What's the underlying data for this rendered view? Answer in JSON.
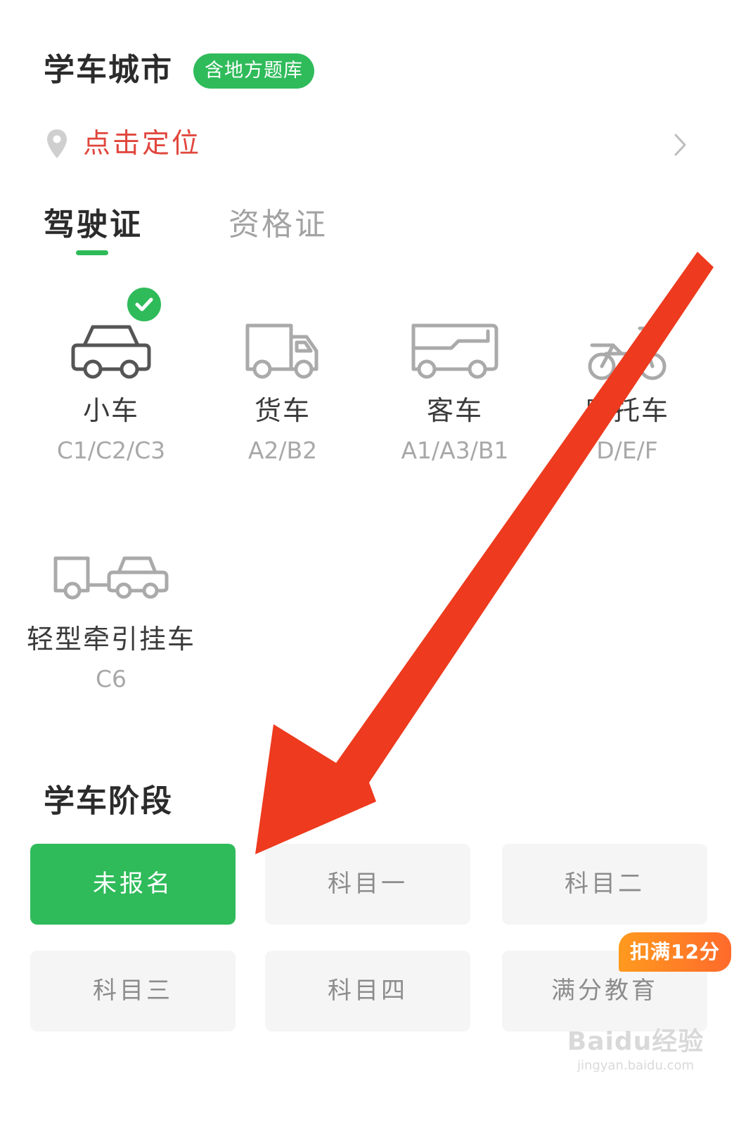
{
  "header": {
    "title": "学车城市",
    "badge": "含地方题库"
  },
  "location": {
    "icon": "location-pin-icon",
    "text": "点击定位",
    "chevron": "chevron-right-icon"
  },
  "tabs": [
    {
      "label": "驾驶证",
      "active": true
    },
    {
      "label": "资格证",
      "active": false
    }
  ],
  "vehicles": [
    {
      "name": "小车",
      "code": "C1/C2/C3",
      "icon": "car-icon",
      "selected": true
    },
    {
      "name": "货车",
      "code": "A2/B2",
      "icon": "truck-icon",
      "selected": false
    },
    {
      "name": "客车",
      "code": "A1/A3/B1",
      "icon": "bus-icon",
      "selected": false
    },
    {
      "name": "摩托车",
      "code": "D/E/F",
      "icon": "motorcycle-icon",
      "selected": false
    },
    {
      "name": "轻型牵引挂车",
      "code": "C6",
      "icon": "trailer-icon",
      "selected": false
    }
  ],
  "stage": {
    "title": "学车阶段",
    "buttons": [
      {
        "label": "未报名",
        "active": true
      },
      {
        "label": "科目一",
        "active": false
      },
      {
        "label": "科目二",
        "active": false
      },
      {
        "label": "科目三",
        "active": false
      },
      {
        "label": "科目四",
        "active": false
      },
      {
        "label": "满分教育",
        "active": false
      }
    ],
    "promo_badge": "扣满12分"
  },
  "watermark": {
    "main": "Baidu经验",
    "url": "jingyan.baidu.com"
  },
  "colors": {
    "accent_green": "#2fbb5a",
    "location_red": "#e0463d",
    "promo_orange": "#ff7a25",
    "arrow_red": "#ee3a1e"
  }
}
